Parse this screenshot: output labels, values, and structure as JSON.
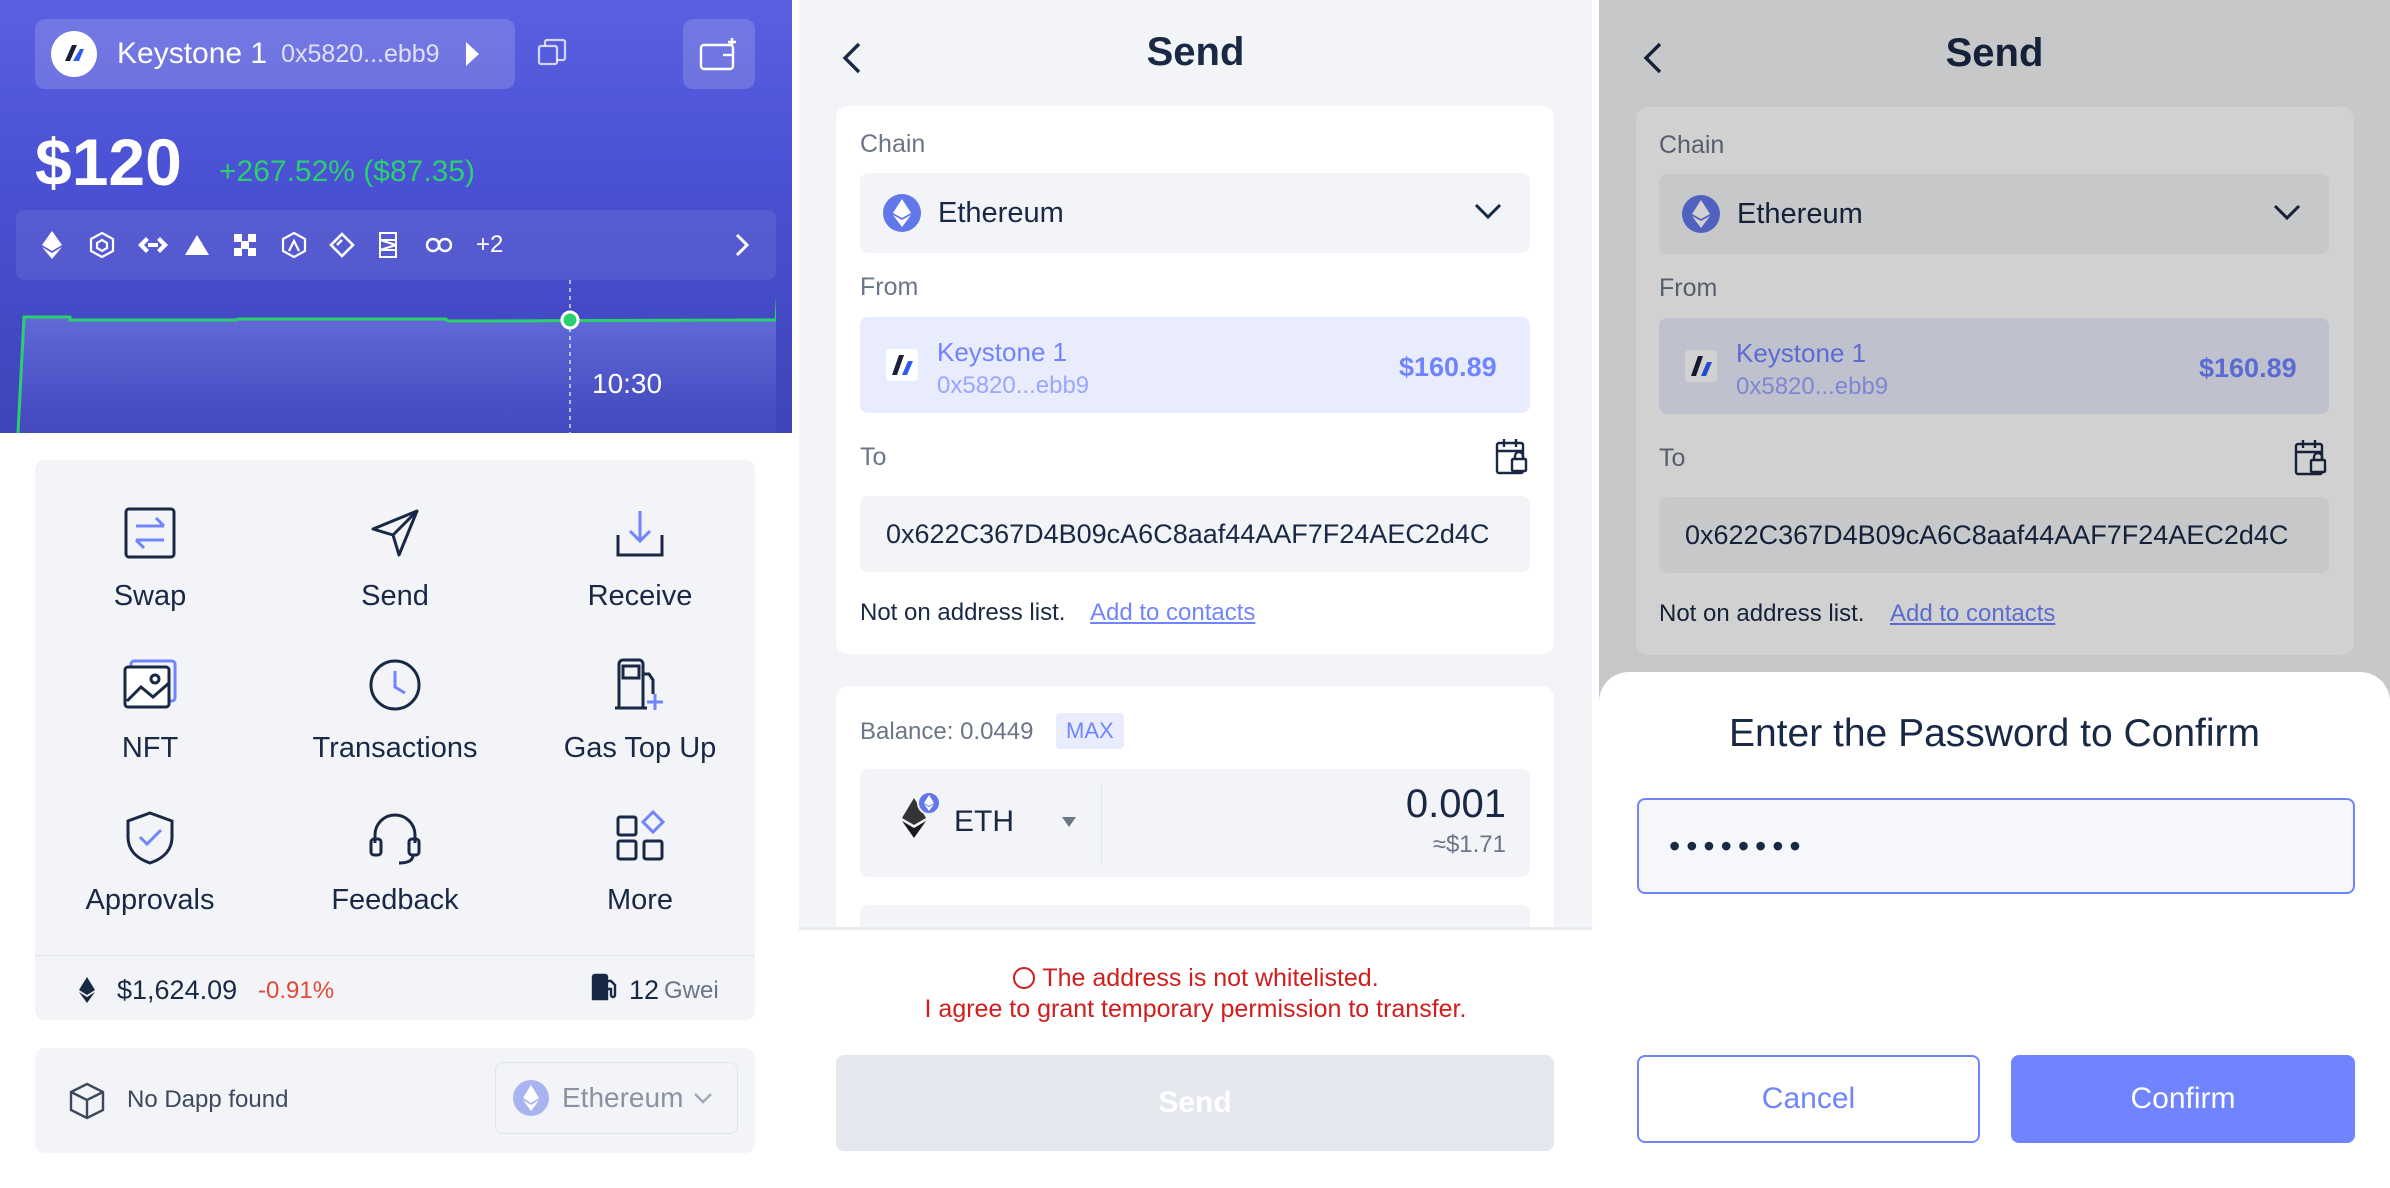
{
  "home": {
    "account_name": "Keystone 1",
    "account_address": "0x5820...ebb9",
    "balance": "$120",
    "change": "+267.52% ($87.35)",
    "chain_more": "+2",
    "chart_time": "10:30",
    "actions": [
      {
        "label": "Swap",
        "icon": "swap-icon"
      },
      {
        "label": "Send",
        "icon": "send-icon"
      },
      {
        "label": "Receive",
        "icon": "receive-icon"
      },
      {
        "label": "NFT",
        "icon": "nft-icon"
      },
      {
        "label": "Transactions",
        "icon": "clock-icon"
      },
      {
        "label": "Gas Top Up",
        "icon": "gas-icon"
      },
      {
        "label": "Approvals",
        "icon": "shield-icon"
      },
      {
        "label": "Feedback",
        "icon": "headset-icon"
      },
      {
        "label": "More",
        "icon": "grid-icon"
      }
    ],
    "eth_price": "$1,624.09",
    "eth_change": "-0.91%",
    "gas_value": "12",
    "gas_unit": "Gwei",
    "dapp_text": "No Dapp found",
    "dapp_chain": "Ethereum"
  },
  "send": {
    "title": "Send",
    "chain_label": "Chain",
    "chain": "Ethereum",
    "from_label": "From",
    "from_name": "Keystone 1",
    "from_address": "0x5820...ebb9",
    "from_usd": "$160.89",
    "to_label": "To",
    "to_address": "0x622C367D4B09cA6C8aaf44AAF7F24AEC2d4C",
    "not_on_list": "Not on address list.",
    "add_contacts": "Add to contacts",
    "balance": "Balance: 0.0449",
    "max": "MAX",
    "token": "ETH",
    "amount": "0.001",
    "amount_usd": "≈$1.71",
    "whitelist_warning": "The address is not whitelisted.",
    "whitelist_agree": "I agree to grant temporary permission to transfer.",
    "send_button": "Send"
  },
  "confirm": {
    "title": "Send",
    "chain_label": "Chain",
    "chain": "Ethereum",
    "from_label": "From",
    "from_name": "Keystone 1",
    "from_address": "0x5820...ebb9",
    "from_usd": "$160.89",
    "to_label": "To",
    "to_address": "0x622C367D4B09cA6C8aaf44AAF7F24AEC2d4C",
    "not_on_list": "Not on address list.",
    "add_contacts": "Add to contacts",
    "sheet_title": "Enter the Password to Confirm",
    "password_value": "••••••••",
    "cancel": "Cancel",
    "confirm": "Confirm"
  },
  "colors": {
    "brand": "#7084FF",
    "hero": "#4B51D4",
    "positive": "#2BD06E",
    "negative": "#E34935",
    "warning": "#D11D1D"
  }
}
